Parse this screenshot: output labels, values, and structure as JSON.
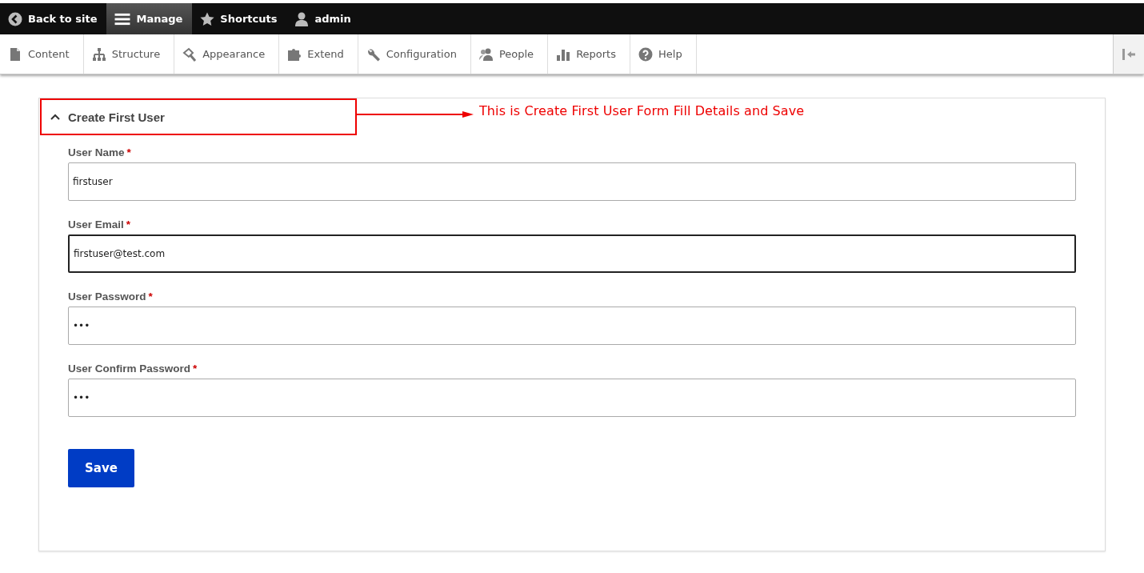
{
  "toolbar": {
    "items": [
      {
        "label": "Back to site",
        "selected": false
      },
      {
        "label": "Manage",
        "selected": true
      },
      {
        "label": "Shortcuts",
        "selected": false
      },
      {
        "label": "admin",
        "selected": false
      }
    ]
  },
  "tray": {
    "items": [
      {
        "label": "Content"
      },
      {
        "label": "Structure"
      },
      {
        "label": "Appearance"
      },
      {
        "label": "Extend"
      },
      {
        "label": "Configuration"
      },
      {
        "label": "People"
      },
      {
        "label": "Reports"
      },
      {
        "label": "Help"
      }
    ]
  },
  "form": {
    "title": "Create First User",
    "expanded": true,
    "fields": [
      {
        "label": "User Name",
        "required_mark": "*",
        "value": "firstuser",
        "focused": false
      },
      {
        "label": "User Email",
        "required_mark": "*",
        "value": "firstuser@test.com",
        "focused": true
      },
      {
        "label": "User Password",
        "required_mark": "*",
        "value": "•••",
        "focused": false
      },
      {
        "label": "User Confirm Password",
        "required_mark": "*",
        "value": "•••",
        "focused": false
      }
    ],
    "submit": "Save"
  },
  "annotation": {
    "text": "This is Create First User Form Fill Details and Save"
  }
}
